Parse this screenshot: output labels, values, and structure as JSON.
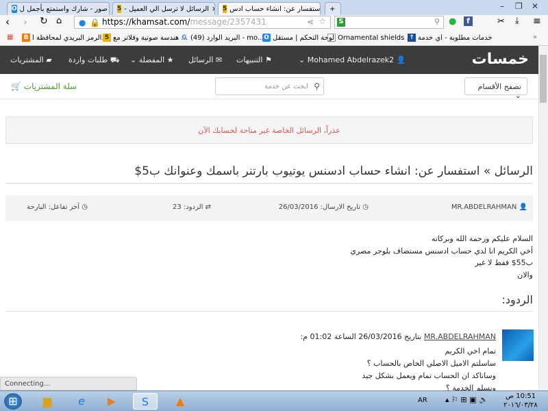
{
  "browser": {
    "tabs": [
      {
        "title": "استفسار عن: انشاء حساب ادس",
        "favicon": "khamsat-5",
        "active": true
      },
      {
        "title": "- الرسائل لا ترسل الي العميل",
        "favicon": "khamsat-5",
        "active": false
      },
      {
        "title": "صور - شارك واستمتع بأجمل ل",
        "favicon": "blue-o",
        "active": false
      }
    ],
    "url_host": "https://khamsat.com/",
    "url_path": "message/2357431",
    "search_engine_icon": "S",
    "bookmarks": [
      "الرمز البريدي لمحافظة ا...",
      "هندسة صوتية وفلاتر مع ...",
      "(49) البريد الوارد - mo...",
      "لوحة التحكم | مستقل",
      "Ornamental shields ...",
      "خدمات مطلوبة - اي خدمة"
    ],
    "more_bookmarks": "»",
    "status": "Connecting..."
  },
  "nav": {
    "logo": "خمسات",
    "user": "Mohamed Abdelrazek2",
    "items": [
      "التنبيهات",
      "الرسائل",
      "المفضلة",
      "طلبات واردة",
      "المشتريات"
    ]
  },
  "subbar": {
    "categories": "تصفح الأقسام",
    "search_placeholder": "ابحث عن خدمة",
    "cart": "سلة المشتريات"
  },
  "alert": "عذراً، الرسائل الخاصة غير متاحة لحسابك الآن",
  "title": "الرسائل » استفسار عن: انشاء حساب ادسنس يوتيوب بارتنر باسمك وعنوانك ب5$",
  "meta": {
    "author": "MR.ABDELRAHMAN",
    "sent": "تاريخ الارسال: 26/03/2016",
    "replies": "الردود: 23",
    "last": "آخر تفاعل: البارحة"
  },
  "message": [
    "السلام عليكم ورحمة الله وبركاته",
    "أخي الكريم انا لدي حساب ادسنس مستضاف بلوجر مصري",
    "ب55$ فقط لا غير",
    "والان"
  ],
  "replies_heading": "الردود:",
  "reply": {
    "author": "MR.ABDELRAHMAN",
    "header": "بتاريخ 26/03/2016 الساعة 01:02 م:",
    "lines": [
      "تمام اخي الكريم",
      "ساسلتم الاميل الاصلي الخاص بالحساب ؟",
      "وساتاكد ان الحساب تمام ويعمل بشكل جيد",
      "ونسلم الخدمة ؟"
    ]
  },
  "taskbar": {
    "lang": "AR",
    "time": "10:51 ص",
    "date": "٢٠١٦/٠٣/٢٨"
  },
  "colors": {
    "nav": "#3c3c3c",
    "alert_text": "#d9534f",
    "cart": "#4a9b2c",
    "logo_accent": "#f0b400"
  }
}
